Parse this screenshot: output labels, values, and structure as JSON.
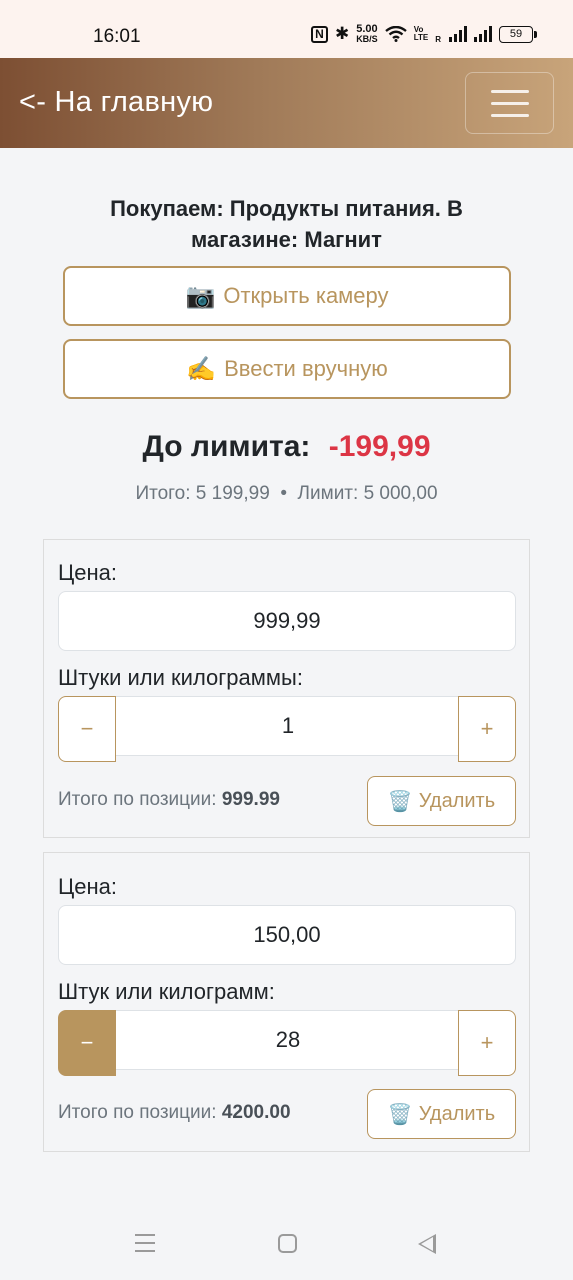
{
  "status_bar": {
    "time": "16:01",
    "net_speed_value": "5.00",
    "net_speed_unit": "KB/S",
    "volte_top": "Vo",
    "volte_bottom": "LTE",
    "roaming": "R",
    "battery": "59",
    "icons": [
      "nfc-icon",
      "bluetooth-icon",
      "wifi-icon",
      "signal-icon",
      "signal-icon",
      "battery-icon"
    ]
  },
  "header": {
    "back_label": "<- На главную",
    "menu_icon": "hamburger-icon"
  },
  "shop": {
    "title": "Покупаем: Продукты питания. В магазине: Магнит"
  },
  "actions": {
    "camera_icon": "📷",
    "camera_label": "Открыть камеру",
    "manual_icon": "✍️",
    "manual_label": "Ввести вручную"
  },
  "summary": {
    "limit_label": "До лимита:",
    "limit_value": "-199,99",
    "total_text": "Итого: 5 199,99",
    "separator": "•",
    "limit_text": "Лимит: 5 000,00"
  },
  "items": [
    {
      "price_label": "Цена:",
      "price": "999,99",
      "qty_label": "Штуки или килограммы:",
      "qty": "1",
      "minus": "−",
      "plus": "+",
      "total_label": "Итого по позиции:",
      "total_value": "999.99",
      "delete_icon": "🗑️",
      "delete_label": "Удалить"
    },
    {
      "price_label": "Цена:",
      "price": "150,00",
      "qty_label": "Штук или килограмм:",
      "qty": "28",
      "minus": "−",
      "plus": "+",
      "total_label": "Итого по позиции:",
      "total_value": "4200.00",
      "delete_icon": "🗑️",
      "delete_label": "Удалить"
    }
  ],
  "colors": {
    "accent": "#b8955e",
    "negative": "#dc3545",
    "header_start": "#7d4f33",
    "header_end": "#c8a47a"
  }
}
